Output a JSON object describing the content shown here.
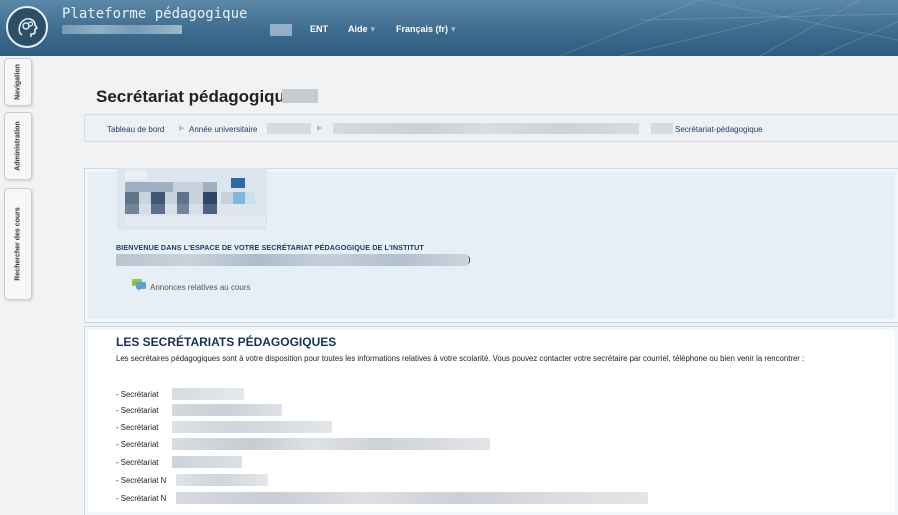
{
  "header": {
    "site_title": "Plateforme pédagogique",
    "menu": [
      {
        "label": "ENT",
        "has_caret": false
      },
      {
        "label": "Aide",
        "has_caret": true
      },
      {
        "label": "Français (fr)",
        "has_caret": true
      }
    ]
  },
  "side_tabs": [
    {
      "label": "Navigation"
    },
    {
      "label": "Administration"
    },
    {
      "label": "Rechercher des cours"
    }
  ],
  "page": {
    "title": "Secrétariat pédagogique",
    "breadcrumb": [
      {
        "label": "Tableau de bord"
      },
      {
        "label": "Année universitaire"
      },
      {
        "label": "Secrétariat-pédagogique"
      }
    ]
  },
  "welcome_block": {
    "heading": "BIENVENUE DANS L'ESPACE DE VOTRE SECRÉTARIAT PÉDAGOGIQUE DE L'INSTITUT",
    "closing_paren": ")",
    "forum_label": "Annonces relatives au cours"
  },
  "secretariats": {
    "heading": "LES SECRÉTARIATS PÉDAGOGIQUES",
    "description": "Les secrétaires pédagogiques sont à votre disposition pour toutes les informations relatives à votre scolarité. Vous pouvez contacter votre secrétaire par courriel, téléphone ou bien venir la rencontrer :",
    "items": [
      {
        "label": "- Secrétariat"
      },
      {
        "label": "- Secrétariat"
      },
      {
        "label": "- Secrétariat"
      },
      {
        "label": "- Secrétariat"
      },
      {
        "label": "- Secrétariat"
      },
      {
        "label": "- Secrétariat N"
      },
      {
        "label": "- Secrétariat N"
      }
    ]
  },
  "colors": {
    "header_top": "#5b88a6",
    "header_bottom": "#2f5c7e",
    "link": "#1c3f66",
    "heading": "#17305a",
    "block_bg": "#e6eef6"
  }
}
